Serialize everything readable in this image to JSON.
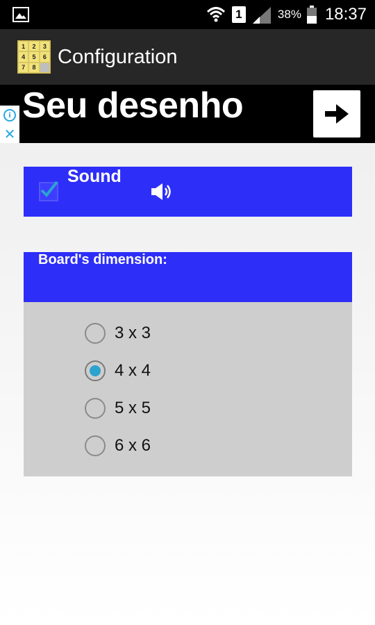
{
  "status_bar": {
    "sim_slot": "1",
    "battery": "38%",
    "time": "18:37"
  },
  "app_bar": {
    "title": "Configuration",
    "icon_tiles": [
      "1",
      "2",
      "3",
      "4",
      "5",
      "6",
      "7",
      "8",
      ""
    ]
  },
  "ad": {
    "text": "Seu desenho",
    "info_glyph": "i",
    "close_glyph": "✕"
  },
  "sound": {
    "label": "Sound",
    "checked": true
  },
  "board": {
    "title": "Board's dimension:",
    "options": [
      {
        "label": "3 x 3",
        "selected": false
      },
      {
        "label": "4 x 4",
        "selected": true
      },
      {
        "label": "5 x 5",
        "selected": false
      },
      {
        "label": "6 x 6",
        "selected": false
      }
    ]
  },
  "colors": {
    "panel_blue": "#2e2ef9",
    "radio_accent": "#2aa3cf",
    "checkmark": "#2aa3cf"
  }
}
